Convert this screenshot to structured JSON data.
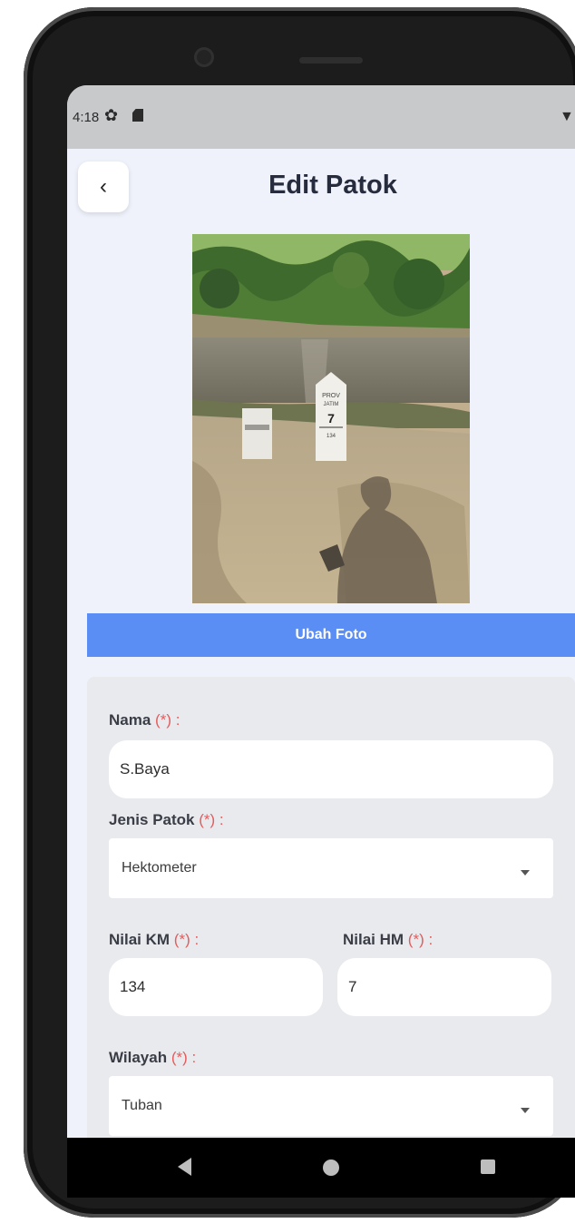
{
  "status": {
    "time": "4:18",
    "icons": [
      "gear-icon",
      "sd-card-icon",
      "wifi-icon",
      "signal-icon",
      "battery-icon"
    ]
  },
  "header": {
    "title": "Edit Patok",
    "back_icon": "chevron-left-icon"
  },
  "photo": {
    "marker_main": {
      "line1": "PROV",
      "line2": "JATIM",
      "number": "7",
      "bottom": "134"
    }
  },
  "actions": {
    "change_photo": "Ubah Foto"
  },
  "form": {
    "required_marker": "(*)",
    "nama": {
      "label": "Nama",
      "value": "S.Baya"
    },
    "jenis": {
      "label": "Jenis Patok",
      "value": "Hektometer"
    },
    "km": {
      "label": "Nilai KM",
      "value": "134"
    },
    "hm": {
      "label": "Nilai HM",
      "value": "7"
    },
    "wilayah": {
      "label": "Wilayah",
      "value": "Tuban"
    }
  },
  "colors": {
    "primary": "#5b8ef4",
    "required": "#e45c5c",
    "background": "#eff2fb"
  }
}
